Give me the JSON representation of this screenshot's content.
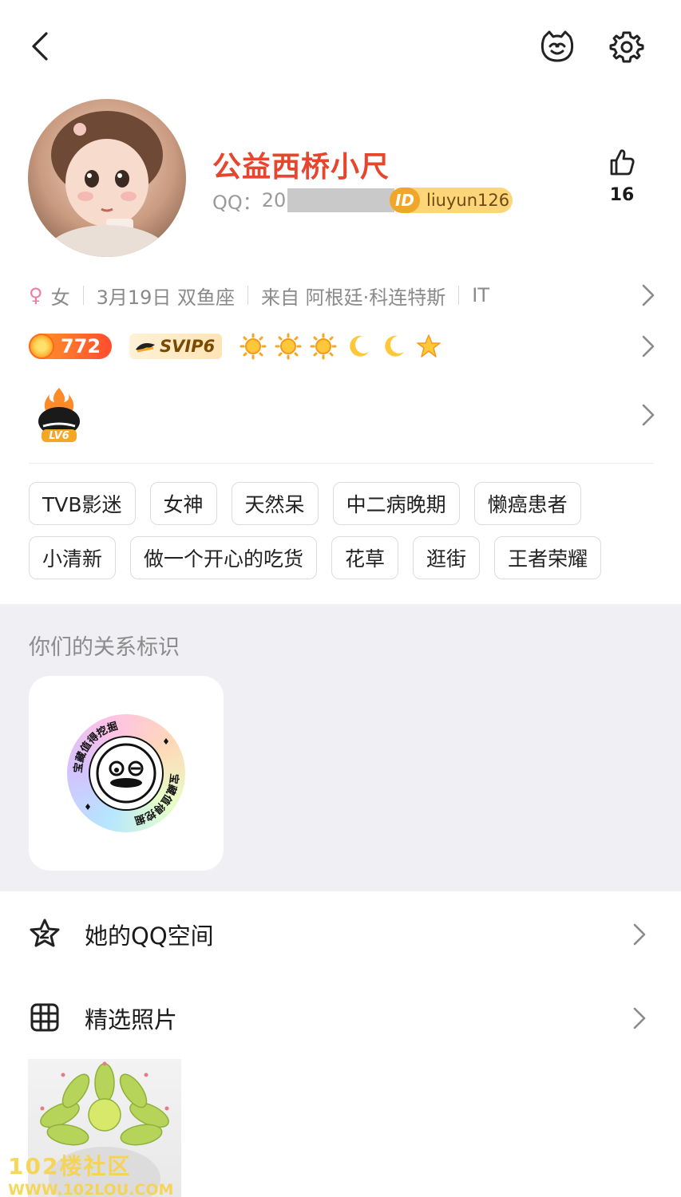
{
  "profile": {
    "nickname": "公益西桥小尺",
    "qq_label": "QQ：",
    "qq_number_visible": "20",
    "id_icon": "ID",
    "id_handle": "liuyun126",
    "likes": "16"
  },
  "info": {
    "gender_symbol": "♀",
    "gender": "女",
    "birthday": "3月19日 双鱼座",
    "location": "来自 阿根廷·科连特斯",
    "occupation": "IT"
  },
  "levels": {
    "fire_value": "772",
    "svip": "SVIP6",
    "level_icons": [
      "sun",
      "sun",
      "sun",
      "moon",
      "moon",
      "star"
    ],
    "lv_badge": "LV6"
  },
  "tags": [
    [
      "TVB影迷",
      "女神",
      "天然呆",
      "中二病晚期",
      "懒癌患者"
    ],
    [
      "小清新",
      "做一个开心的吃货",
      "花草",
      "逛街",
      "王者荣耀"
    ]
  ],
  "relation": {
    "title": "你们的关系标识",
    "badge_text": "宝藏值得挖掘"
  },
  "menu": {
    "qzone": "她的QQ空间",
    "photos": "精选照片"
  },
  "watermark": {
    "line1": "102楼社区",
    "line2": "WWW.102LOU.COM"
  },
  "icons": {
    "back": "back-arrow-icon",
    "pet": "pet-face-icon",
    "settings": "gear-icon",
    "like": "thumbs-up-icon",
    "chevron": "chevron-right-icon",
    "qzone": "star-icon",
    "photos": "grid-icon"
  },
  "colors": {
    "nickname": "#e8452e",
    "id_badge": "#ffd57a",
    "relation_bg": "#efeff4",
    "secondary_text": "#8a8a8a"
  }
}
